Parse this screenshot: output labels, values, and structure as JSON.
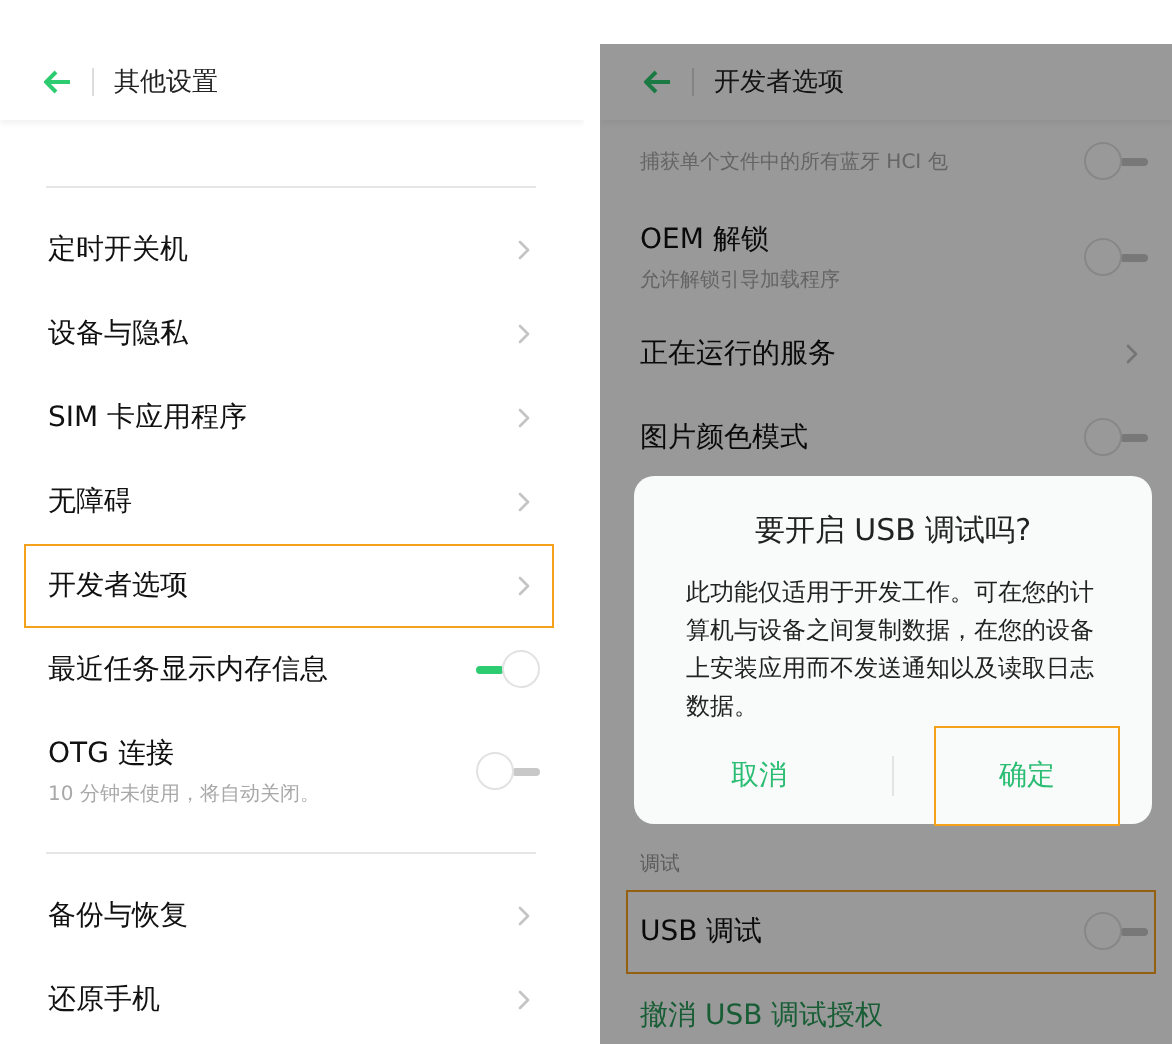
{
  "left_screen": {
    "title": "其他设置",
    "sections": [
      {
        "items": [
          {
            "kind": "link",
            "title": "定时开关机",
            "highlighted": false
          },
          {
            "kind": "link",
            "title": "设备与隐私",
            "highlighted": false
          },
          {
            "kind": "link",
            "title": "SIM 卡应用程序",
            "highlighted": false
          },
          {
            "kind": "link",
            "title": "无障碍",
            "highlighted": false
          },
          {
            "kind": "link",
            "title": "开发者选项",
            "highlighted": true
          },
          {
            "kind": "toggle",
            "title": "最近任务显示内存信息",
            "on": true,
            "highlighted": false
          },
          {
            "kind": "toggle",
            "title": "OTG 连接",
            "subtitle": "10 分钟未使用，将自动关闭。",
            "on": false,
            "highlighted": false
          }
        ]
      },
      {
        "items": [
          {
            "kind": "link",
            "title": "备份与恢复",
            "highlighted": false
          },
          {
            "kind": "link",
            "title": "还原手机",
            "highlighted": false
          }
        ]
      }
    ]
  },
  "right_screen": {
    "title": "开发者选项",
    "items": [
      {
        "kind": "toggle",
        "subtitle": "捕获单个文件中的所有蓝牙 HCI 包",
        "on": false,
        "highlighted": false
      },
      {
        "kind": "toggle",
        "title": "OEM 解锁",
        "subtitle": "允许解锁引导加载程序",
        "on": false,
        "highlighted": false
      },
      {
        "kind": "link",
        "title": "正在运行的服务",
        "highlighted": false
      },
      {
        "kind": "toggle",
        "title": "图片颜色模式",
        "on": false,
        "highlighted": false
      },
      {
        "kind": "header",
        "title": "调试"
      },
      {
        "kind": "toggle",
        "title": "USB 调试",
        "on": false,
        "highlighted": true
      },
      {
        "kind": "action",
        "title": "撤消 USB 调试授权"
      }
    ],
    "dialog": {
      "title": "要开启 USB 调试吗?",
      "message": "此功能仅适用于开发工作。可在您的计算机与设备之间复制数据，在您的设备上安装应用而不发送通知以及读取日志数据。",
      "buttons": [
        {
          "label": "取消",
          "highlighted": false
        },
        {
          "label": "确定",
          "highlighted": true
        }
      ]
    }
  }
}
